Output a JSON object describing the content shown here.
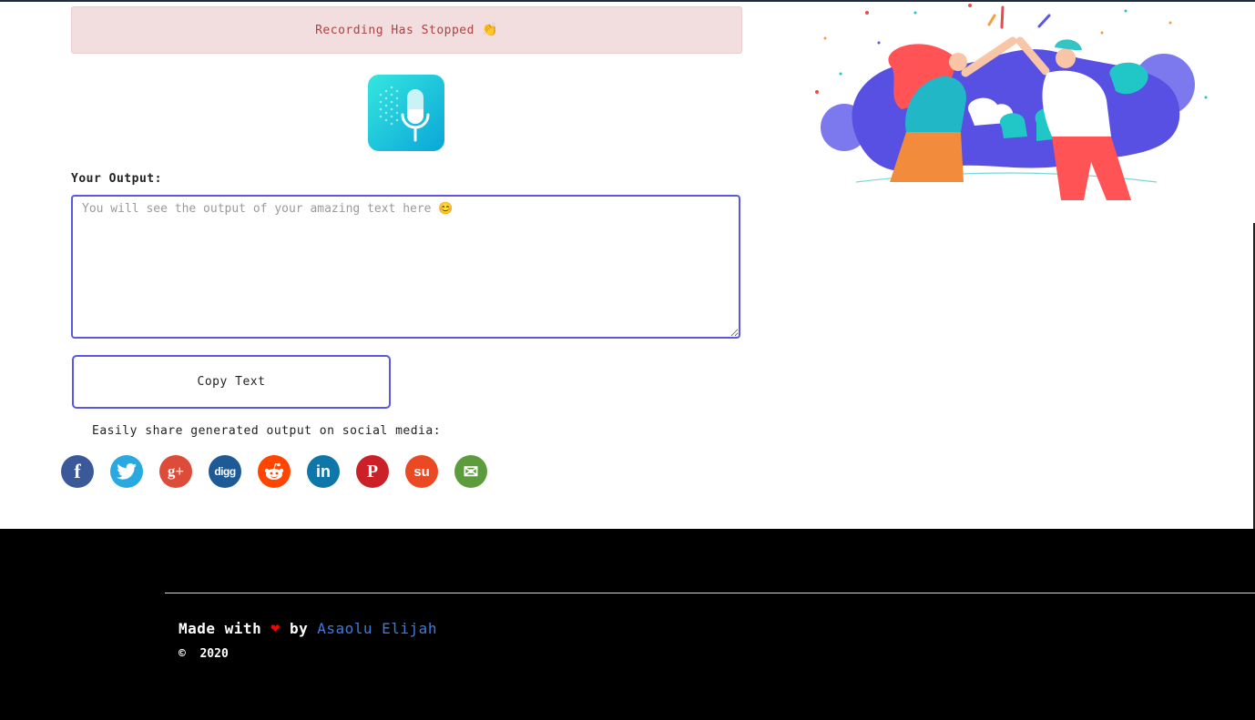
{
  "alert": {
    "text": "Recording Has Stopped",
    "emoji": "👏"
  },
  "mic": {
    "icon": "microphone-icon"
  },
  "output": {
    "label": "Your Output:",
    "placeholder": "You will see the output of your amazing text here 😊",
    "value": ""
  },
  "copy_button": {
    "label": "Copy Text"
  },
  "share": {
    "text": "Easily share generated output on social media:",
    "networks": [
      {
        "name": "facebook",
        "glyph": "f",
        "color": "#3b5998"
      },
      {
        "name": "twitter",
        "glyph": "🐦",
        "color": "#2aa9e0"
      },
      {
        "name": "google-plus",
        "glyph": "g+",
        "color": "#dd4b39"
      },
      {
        "name": "digg",
        "glyph": "digg",
        "color": "#1d5a96"
      },
      {
        "name": "reddit",
        "glyph": "👽",
        "color": "#ff4500"
      },
      {
        "name": "linkedin",
        "glyph": "in",
        "color": "#0e76a8"
      },
      {
        "name": "pinterest",
        "glyph": "P",
        "color": "#cb2027"
      },
      {
        "name": "stumbleupon",
        "glyph": "su",
        "color": "#eb4924"
      },
      {
        "name": "email",
        "glyph": "✉",
        "color": "#5d9c3d"
      }
    ]
  },
  "footer": {
    "made_with": "Made with",
    "by": "by",
    "author": "Asaolu Elijah",
    "copyright_symbol": "©",
    "year": "2020"
  },
  "colors": {
    "accent": "#5b57e0",
    "alert_bg": "#f2dede",
    "alert_text": "#a94442",
    "link": "#3f7bd9"
  }
}
